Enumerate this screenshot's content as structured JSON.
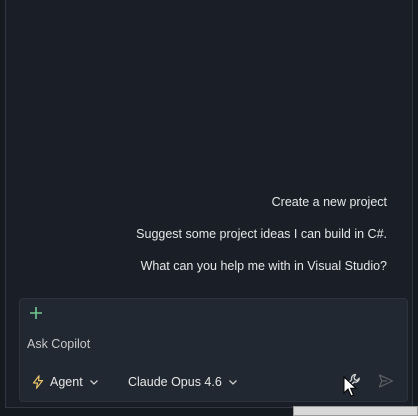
{
  "suggestions": [
    {
      "label": "Create a new project"
    },
    {
      "label": "Suggest some project ideas I can build in C#."
    },
    {
      "label": "What can you help me with in Visual Studio?"
    }
  ],
  "input": {
    "placeholder": "Ask Copilot",
    "value": ""
  },
  "toolbar": {
    "mode_label": "Agent",
    "model_label": "Claude Opus 4.6"
  },
  "colors": {
    "accent_green": "#73c991",
    "agent_icon": "#e8c26a",
    "background": "#1a1f27",
    "input_background": "#222831"
  },
  "icons": {
    "add": "plus-icon",
    "mode": "lightning-icon",
    "tools": "wrench-icon",
    "send": "send-icon"
  }
}
